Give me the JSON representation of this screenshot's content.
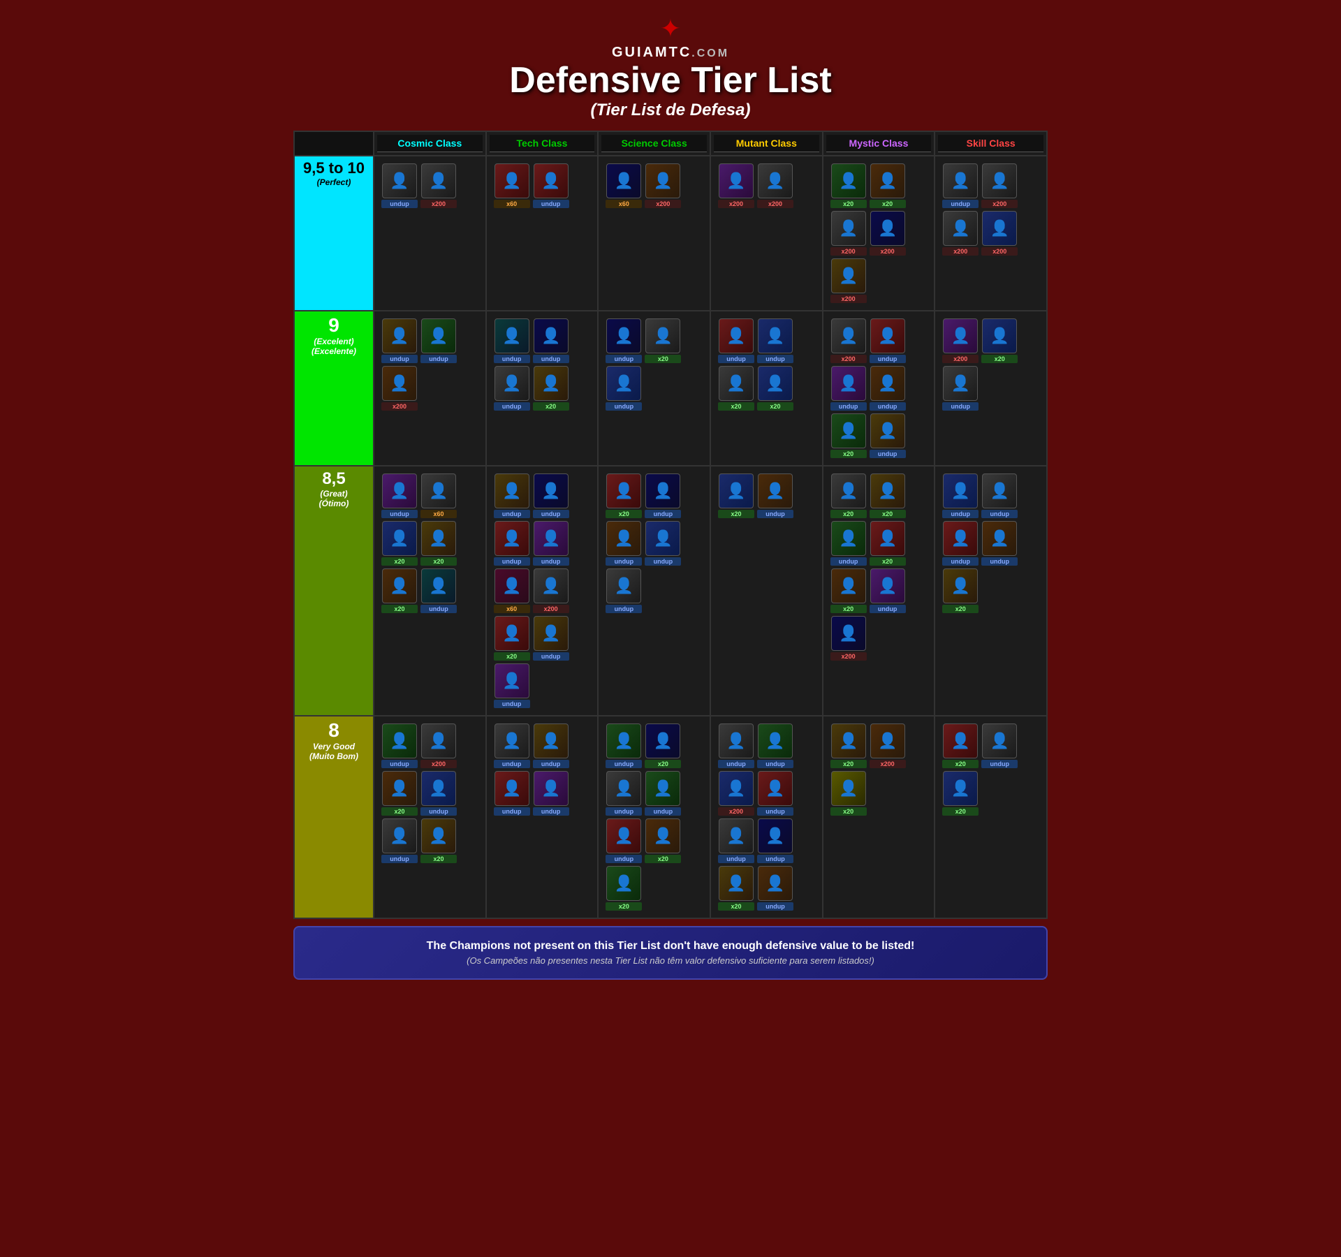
{
  "header": {
    "logo_symbol": "✦",
    "site_name": "GuiaMTC",
    "site_domain": ".com",
    "main_title": "Defensive Tier List",
    "sub_title": "(Tier List de Defesa)"
  },
  "classes": [
    {
      "name": "Cosmic Class",
      "color_class": "cosmic-hdr"
    },
    {
      "name": "Tech Class",
      "color_class": "tech-hdr"
    },
    {
      "name": "Science Class",
      "color_class": "science-hdr"
    },
    {
      "name": "Mutant Class",
      "color_class": "mutant-hdr"
    },
    {
      "name": "Mystic Class",
      "color_class": "mystic-hdr"
    },
    {
      "name": "Skill Class",
      "color_class": "skill-hdr"
    }
  ],
  "tiers": [
    {
      "id": "perfect",
      "label": "9,5 to 10",
      "sub": "(Perfect)",
      "color_class": "tier-perfect",
      "text_dark": true
    },
    {
      "id": "excellent",
      "label": "9",
      "sub": "(Excelent)\n(Excelente)",
      "color_class": "tier-excellent"
    },
    {
      "id": "great",
      "label": "8,5",
      "sub": "(Great)\n(Ótimo)",
      "color_class": "tier-great"
    },
    {
      "id": "verygood",
      "label": "8",
      "sub": "Very Good\n(Muito Bom)",
      "color_class": "tier-verygood"
    }
  ],
  "footer": {
    "main": "The Champions not present on this Tier List don't have enough defensive value to be listed!",
    "sub": "(Os Campeões não presentes nesta Tier List não têm valor defensivo suficiente para serem listados!)"
  }
}
